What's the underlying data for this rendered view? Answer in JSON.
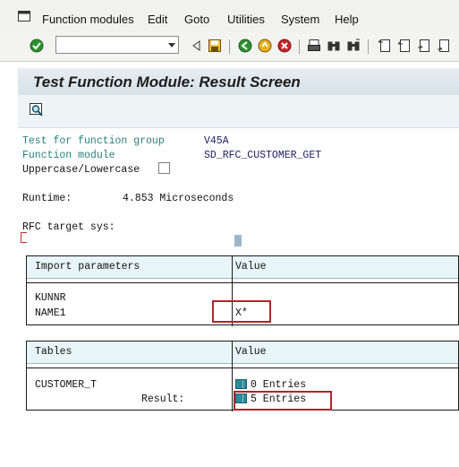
{
  "menu": {
    "items": [
      "Function modules",
      "Edit",
      "Goto",
      "Utilities",
      "System",
      "Help"
    ]
  },
  "toolbar": {
    "command_field_value": ""
  },
  "title": "Test Function Module: Result Screen",
  "header_info": {
    "fg_label": "Test for function group",
    "fg_value": "V45A",
    "fm_label": "Function module",
    "fm_value": "SD_RFC_CUSTOMER_GET",
    "case_label": "Uppercase/Lowercase",
    "case_checked": false,
    "runtime_label": "Runtime:",
    "runtime_value": "4.853 Microseconds",
    "rfc_label": "RFC target sys:"
  },
  "import_table": {
    "col1": "Import parameters",
    "col2": "Value",
    "rows": [
      {
        "name": "KUNNR",
        "value": ""
      },
      {
        "name": "NAME1",
        "value": "X*"
      }
    ]
  },
  "tables_table": {
    "col1": "Tables",
    "col2": "Value",
    "param": "CUSTOMER_T",
    "param_value": "0 Entries",
    "result_label": "Result:",
    "result_value": "5 Entries"
  }
}
